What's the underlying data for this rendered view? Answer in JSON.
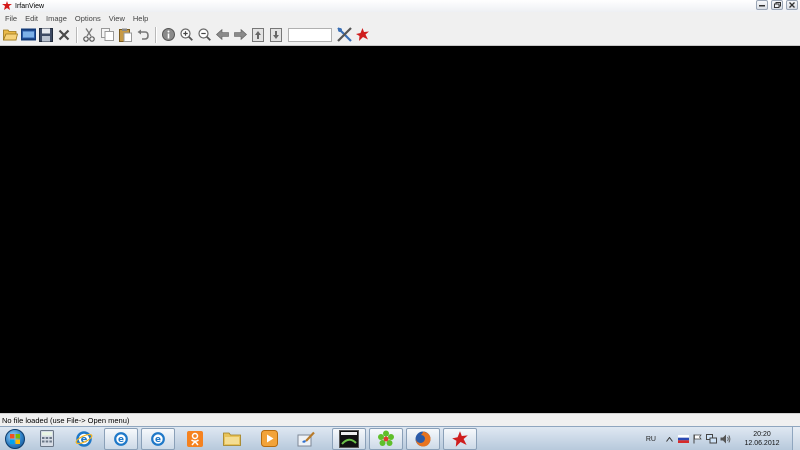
{
  "window": {
    "title": "IrfanView"
  },
  "menu": {
    "items": [
      "File",
      "Edit",
      "Image",
      "Options",
      "View",
      "Help"
    ]
  },
  "toolbar": {
    "buttons": [
      "open-folder-icon",
      "slideshow-icon",
      "save-icon",
      "delete-icon",
      "cut-icon",
      "copy-icon",
      "paste-icon",
      "undo-icon",
      "info-icon",
      "zoom-in-icon",
      "zoom-out-icon",
      "prev-arrow-icon",
      "next-arrow-icon",
      "prev-file-icon",
      "next-file-icon",
      "properties-icon",
      "irfanview-logo-icon"
    ],
    "zoom_value": ""
  },
  "status": {
    "text": "No file loaded (use File-> Open menu)"
  },
  "taskbar": {
    "items": [
      "calculator",
      "internet-explorer",
      "internet-explorer",
      "odnoklassniki",
      "explorer-folder",
      "media-player",
      "paint-net",
      "cpu-z",
      "icq",
      "firefox",
      "irfanview"
    ],
    "language": "RU",
    "time": "20:20",
    "date": "12.06.2012"
  },
  "colors": {
    "canvas": "#000000",
    "chrome": "#f0f0f0",
    "taskbar": "#c9d8e8"
  }
}
